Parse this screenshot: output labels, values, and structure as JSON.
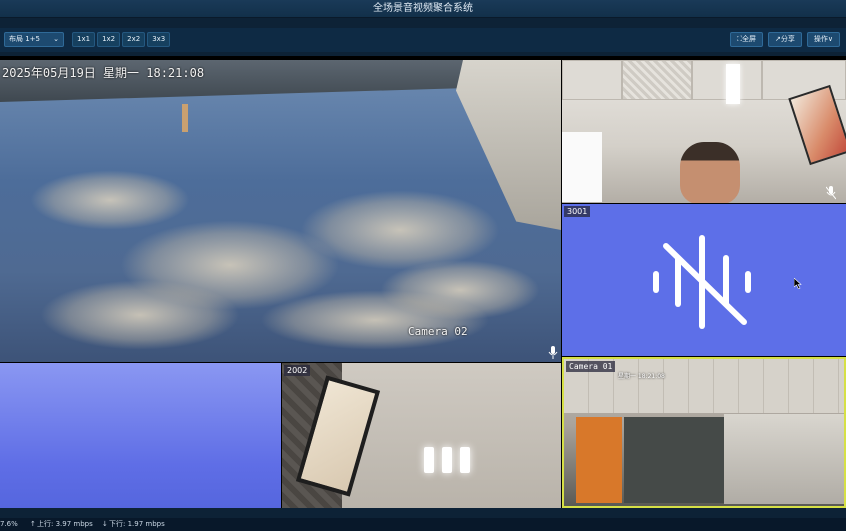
{
  "window": {
    "title": "全场景音视频聚合系统"
  },
  "toolbar": {
    "layout_select": {
      "value": "布局 1+5"
    },
    "grid_buttons": [
      "1x1",
      "1x2",
      "2x2",
      "3x3"
    ],
    "right_buttons": [
      {
        "label": "⛶全屏",
        "icon": "fullscreen-icon"
      },
      {
        "label": "↗分享",
        "icon": "share-icon"
      },
      {
        "label": "操作∨",
        "icon": "chevron-down-icon"
      }
    ]
  },
  "tiles": {
    "main": {
      "timestamp": "2025年05月19日 星期一 18:21:08",
      "camera_label": "Camera 02"
    },
    "audio": {
      "label": "3001"
    },
    "office2": {
      "label": "2002"
    },
    "office3": {
      "camera_label": "Camera 01",
      "timestamp": "星期一 18:21:08"
    }
  },
  "status": {
    "cpu": "7.6%",
    "upload": "上行: 3.97 mbps",
    "download": "下行: 1.97 mbps"
  },
  "colors": {
    "selected_tile_border": "#d6e046",
    "audio_tile_bg": "#5d6fe8",
    "toolbar_bg": "#0e2a44"
  }
}
